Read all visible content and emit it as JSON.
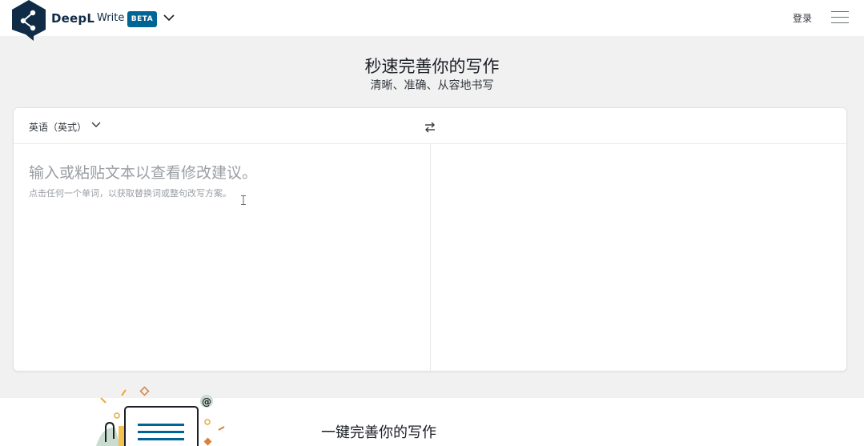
{
  "header": {
    "brand": "DeepL",
    "product": "Write",
    "badge": "BETA",
    "login": "登录",
    "icons": {
      "logo": "deepl-logo",
      "product_menu": "chevron-down-icon",
      "menu": "hamburger-menu-icon"
    }
  },
  "hero": {
    "title": "秒速完善你的写作",
    "subtitle": "清晰、准确、从容地书写"
  },
  "editor": {
    "language": "英语（英式）",
    "placeholder": "输入或粘贴文本以查看修改建议。",
    "hint": "点击任何一个单词，以获取替换词或整句改写方案。",
    "swap_icon": "swap-arrows-icon"
  },
  "feature": {
    "title": "一键完善你的写作"
  },
  "colors": {
    "brand_navy": "#0f2b46",
    "badge_teal": "#006494",
    "page_background": "#f1f1f1"
  }
}
